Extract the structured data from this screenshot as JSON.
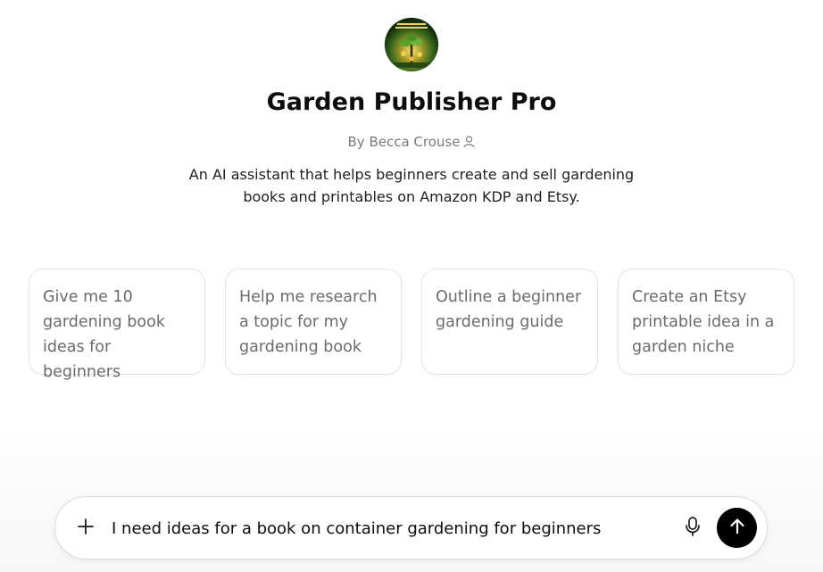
{
  "gpt": {
    "avatar_icon": "book-cover-avatar-icon",
    "title": "Garden Publisher Pro",
    "byline": "By Becca Crouse",
    "description": "An AI assistant that helps beginners create and sell gardening books and printables on Amazon KDP and Etsy."
  },
  "conversation_starters": [
    {
      "label": "Give me 10 gardening book ideas for beginners"
    },
    {
      "label": "Help me research a topic for my gardening book"
    },
    {
      "label": "Outline a beginner gardening guide"
    },
    {
      "label": "Create an Etsy printable idea in a garden niche"
    }
  ],
  "composer": {
    "value": "I need ideas for a book on container gardening for beginners",
    "plus_icon": "plus-icon",
    "mic_icon": "microphone-icon",
    "send_icon": "arrow-up-icon"
  }
}
